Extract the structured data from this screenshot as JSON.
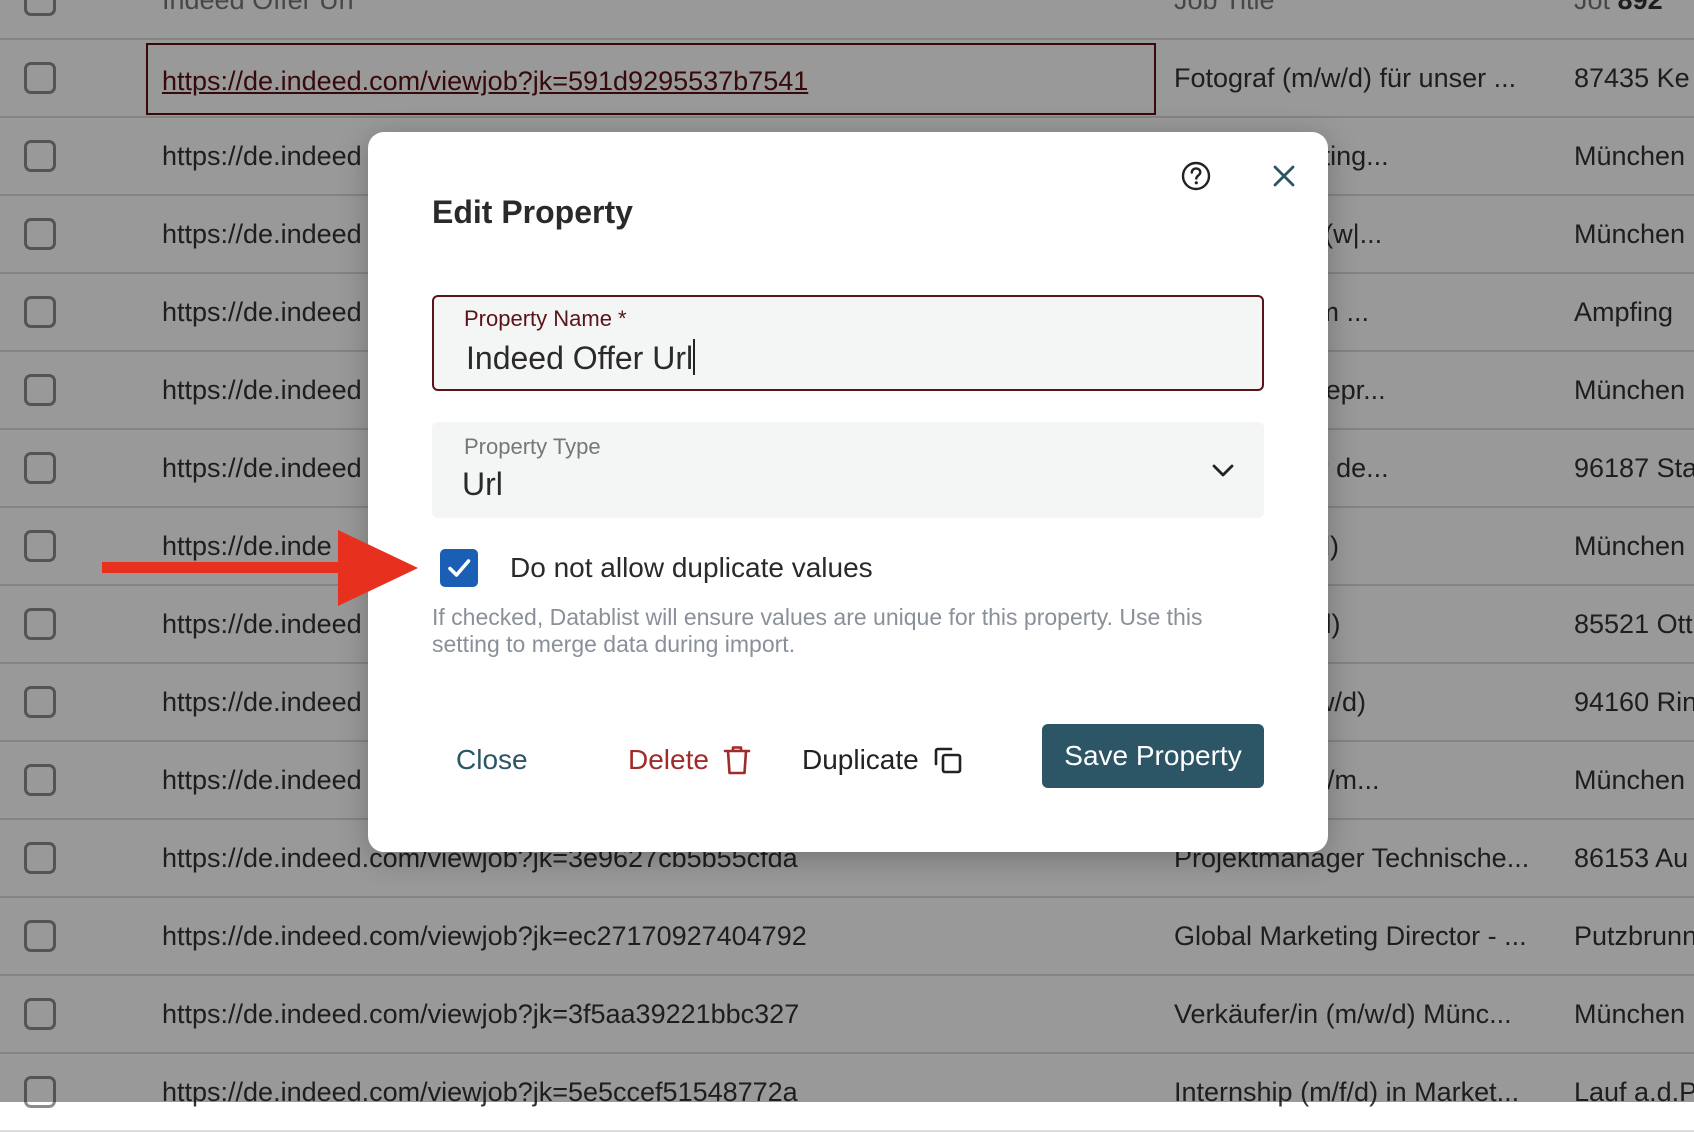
{
  "table": {
    "header": {
      "col1": "Indeed Offer Url",
      "col2": "Job Title",
      "col3_prefix": "Jot",
      "col3_bold": "892"
    },
    "rows": [
      {
        "url": "https://de.indeed.com/viewjob?jk=591d9295537b7541",
        "title": "Fotograf (m/w/d) für unser ...",
        "loc": "87435 Ke"
      },
      {
        "url": "https://de.indeed",
        "title": "oduct Marketing...",
        "loc": "München"
      },
      {
        "url": "https://de.indeed",
        "title": "uktmanager (w|...",
        "loc": "München"
      },
      {
        "url": "https://de.indeed",
        "title": "ter (m/w/d) im ...",
        "loc": "Ampfing"
      },
      {
        "url": "https://de.indeed",
        "title": "velopment Repr...",
        "loc": "München"
      },
      {
        "url": "https://de.indeed",
        "title": "are Agent für de...",
        "loc": "96187 Sta"
      },
      {
        "url": "https://de.inde",
        "title": "cialist (m/w/d)",
        "loc": "München"
      },
      {
        "url": "https://de.indeed",
        "title": "nager (m/w/d)",
        "loc": "85521 Ott"
      },
      {
        "url": "https://de.indeed",
        "title": "Minijob) (m/w/d)",
        "loc": "94160 Rin"
      },
      {
        "url": "https://de.indeed",
        "title": "IINI Sales (w/m...",
        "loc": "München"
      },
      {
        "url": "https://de.indeed.com/viewjob?jk=3e9627cb5b55cfda",
        "title": "Projektmanager Technische...",
        "loc": "86153 Au"
      },
      {
        "url": "https://de.indeed.com/viewjob?jk=ec27170927404792",
        "title": "Global Marketing Director - ...",
        "loc": "Putzbrunn"
      },
      {
        "url": "https://de.indeed.com/viewjob?jk=3f5aa39221bbc327",
        "title": "Verkäufer/in (m/w/d) Münc...",
        "loc": "München"
      },
      {
        "url": "https://de.indeed.com/viewjob?jk=5e5ccef51548772a",
        "title": "Internship (m/f/d) in Market...",
        "loc": "Lauf a.d.P"
      }
    ]
  },
  "modal": {
    "title": "Edit Property",
    "property_name_label": "Property Name *",
    "property_name_value": "Indeed Offer Url",
    "property_type_label": "Property Type",
    "property_type_value": "Url",
    "checkbox_label": "Do not allow duplicate values",
    "checkbox_checked": true,
    "hint": "If checked, Datablist will ensure values are unique for this property. Use this setting to merge data during import.",
    "close_label": "Close",
    "delete_label": "Delete",
    "duplicate_label": "Duplicate",
    "save_label": "Save Property"
  },
  "colors": {
    "accent": "#2c5566",
    "danger": "#a12a2a",
    "checkbox": "#1a5fb4",
    "annotation_arrow": "#e8301f",
    "field_border": "#5a1418"
  },
  "icons": [
    "help-circle-icon",
    "close-icon",
    "chevron-down-icon",
    "check-icon",
    "trash-icon",
    "copy-icon",
    "annotation-arrow"
  ]
}
